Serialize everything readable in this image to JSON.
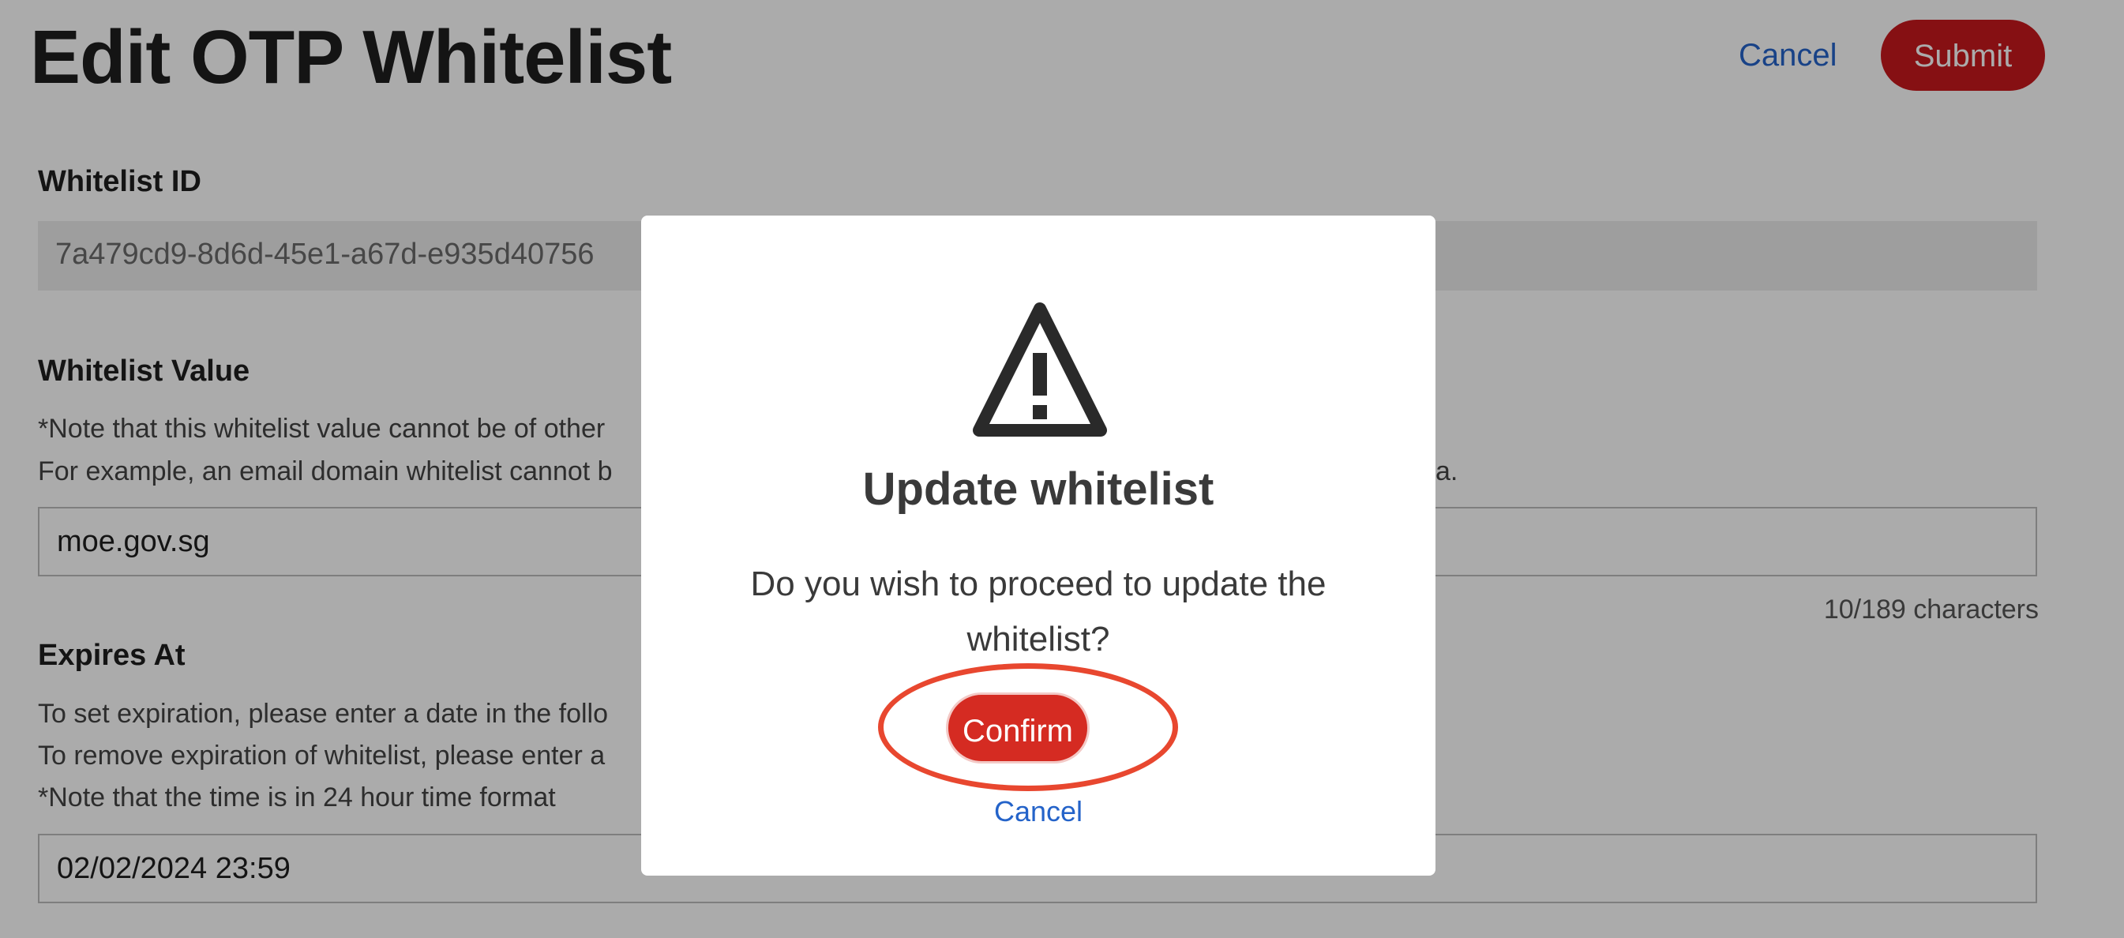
{
  "header": {
    "title": "Edit OTP Whitelist",
    "cancel_label": "Cancel",
    "submit_label": "Submit"
  },
  "form": {
    "whitelist_id": {
      "label": "Whitelist ID",
      "value": "7a479cd9-8d6d-45e1-a67d-e935d40756"
    },
    "whitelist_value": {
      "label": "Whitelist Value",
      "note_line1": "*Note that this whitelist value cannot be of other",
      "note_line2_left": "For example, an email domain whitelist cannot b",
      "note_line2_right": "a.",
      "value": "moe.gov.sg",
      "char_count": "10/189 characters"
    },
    "expires_at": {
      "label": "Expires At",
      "help_line1": "To set expiration, please enter a date in the follo",
      "help_line2": "To remove expiration of whitelist, please enter a",
      "help_line3": "*Note that the time is in 24 hour time format",
      "value": "02/02/2024 23:59"
    }
  },
  "modal": {
    "icon": "warning-triangle-icon",
    "title": "Update whitelist",
    "message": "Do you wish to proceed to update the whitelist?",
    "confirm_label": "Confirm",
    "cancel_label": "Cancel"
  },
  "colors": {
    "primary_red": "#d52b22",
    "link_blue": "#2463c9",
    "highlight_ring": "#e8472f",
    "overlay": "rgba(0,0,0,0.33)"
  }
}
